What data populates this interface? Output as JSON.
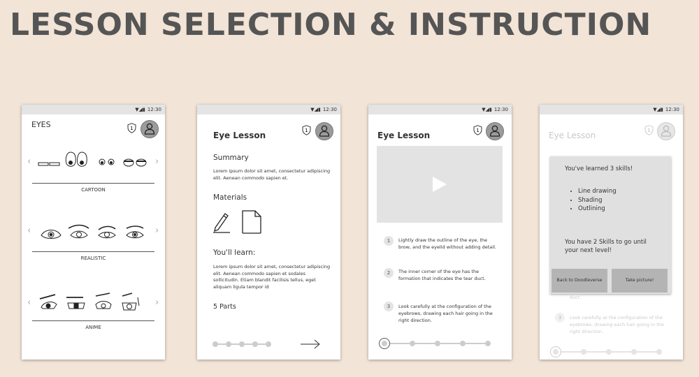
{
  "page_title": "LESSON SELECTION & INSTRUCTION",
  "status_time": "12:30",
  "shield_number": "1",
  "screen1": {
    "title": "EYES",
    "categories": [
      "CARTOON",
      "REALISTIC",
      "ANIME"
    ]
  },
  "screen2": {
    "title": "Eye Lesson",
    "summary_heading": "Summary",
    "summary_text": "Lorem ipsum dolor sit amet, consectetur adipiscing elit. Aenean commodo sapien et.",
    "materials_heading": "Materials",
    "learn_heading": "You'll learn:",
    "learn_text": "Lorem ipsum dolor sit amet, consectetur adipiscing elit. Aenean commodo sapien et sodales sollicitudin. Etiam blandit facilisis tellus, eget aliquam ligula tempor id",
    "parts_heading": "5 Parts"
  },
  "screen3": {
    "title": "Eye Lesson",
    "steps": [
      {
        "num": "1",
        "text": "Lightly draw the outline of the eye, the brow, and the eyelid without adding detail."
      },
      {
        "num": "2",
        "text": "The inner corner of the eye has the formation that indicates the tear duct."
      },
      {
        "num": "3",
        "text": "Look carefully at the configuration of the eyebrows, drawing each hair going in the right direction."
      }
    ]
  },
  "screen4": {
    "title": "Eye Lesson",
    "bg_step_fragment": "duct.",
    "bg_step_num": "3",
    "bg_step_text": "Look carefully at the configuration of the eyebrows, drawing each hair going in the right direction.",
    "dialog": {
      "learned": "You've learned 3 skills!",
      "skills": [
        "Line drawing",
        "Shading",
        "Outlining"
      ],
      "remaining": "You have 2 Skills to go until your next level!",
      "btn_back": "Back to Doodleverse",
      "btn_picture": "Take picture!"
    }
  }
}
